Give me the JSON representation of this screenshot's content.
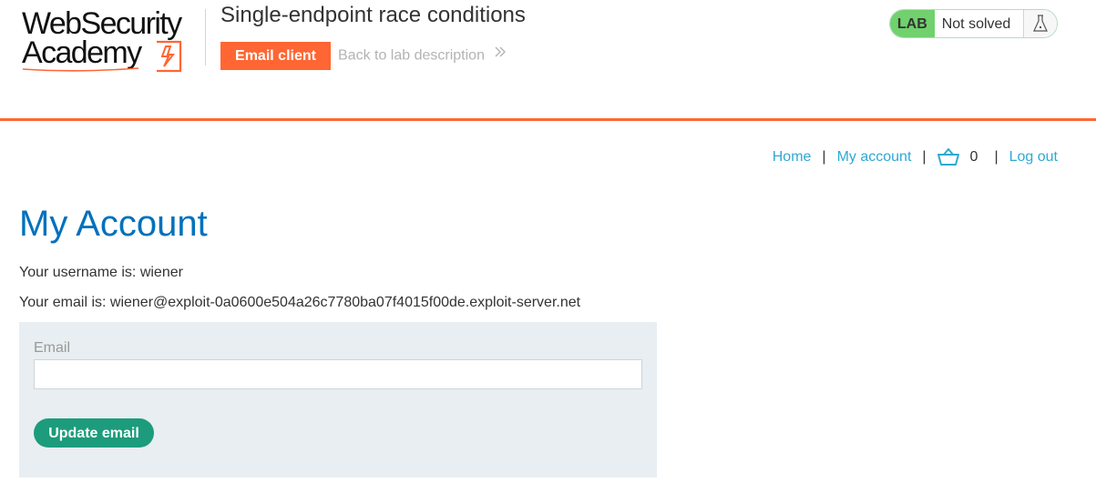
{
  "header": {
    "logo": {
      "line1": "WebSecurity",
      "line2": "Academy"
    },
    "lab_title": "Single-endpoint race conditions",
    "email_client_label": "Email client",
    "back_link_label": "Back to lab description",
    "status": {
      "badge": "LAB",
      "text": "Not solved"
    }
  },
  "nav": {
    "home": "Home",
    "my_account": "My account",
    "cart_count": "0",
    "log_out": "Log out",
    "separator": "|"
  },
  "main": {
    "title": "My Account",
    "username_line": "Your username is: wiener",
    "email_line": "Your email is: wiener@exploit-0a0600e504a26c7780ba07f4015f00de.exploit-server.net",
    "form": {
      "email_label": "Email",
      "email_value": "",
      "submit_label": "Update email"
    }
  },
  "colors": {
    "accent_orange": "#ff6633",
    "link_blue": "#2ea9d3",
    "title_blue": "#0071bc",
    "lab_green": "#70d16d",
    "button_teal": "#1c9c7c",
    "form_background": "#e8eef1"
  },
  "icons": {
    "logo_mark": "lightning-bolt-icon",
    "back_chevron": "double-chevron-right-icon",
    "flask": "flask-icon",
    "cart": "shopping-basket-icon"
  }
}
